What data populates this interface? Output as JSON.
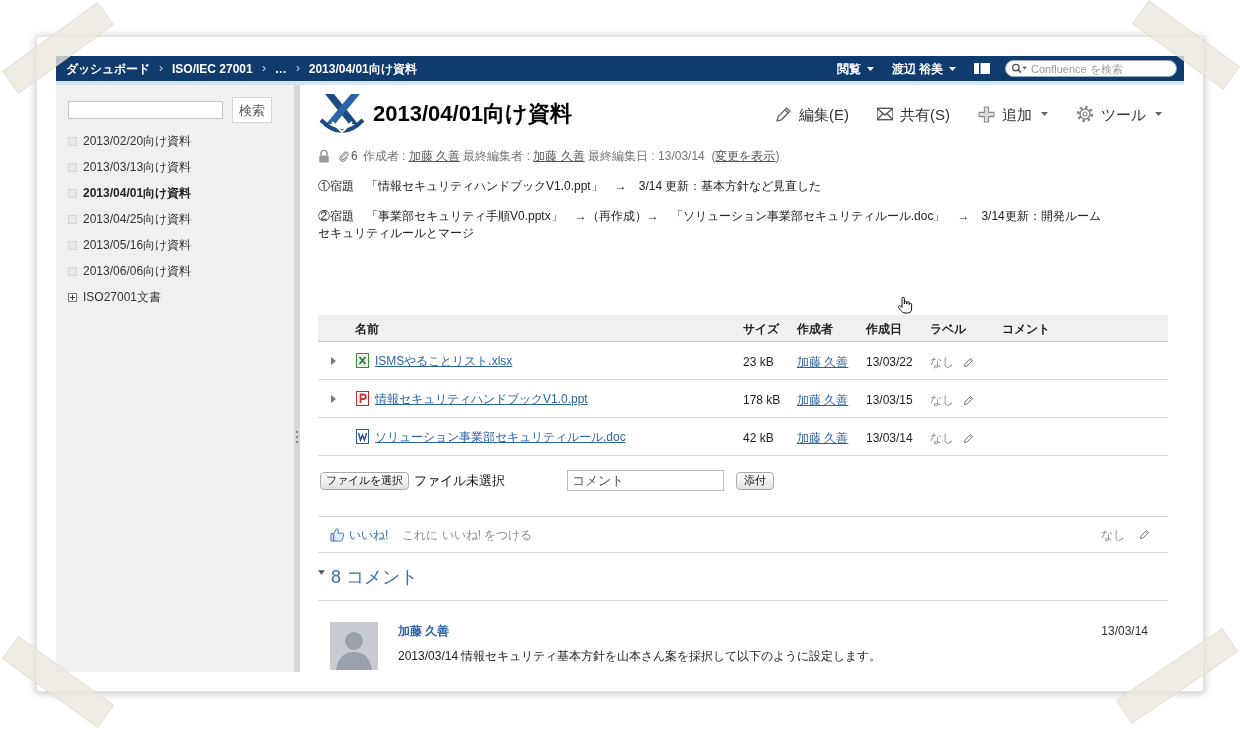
{
  "header": {
    "breadcrumbs": [
      "ダッシュボード",
      "ISO/IEC 27001",
      "…",
      "2013/04/01向け資料"
    ],
    "menus": [
      "閲覧",
      "渡辺 裕美"
    ],
    "search": {
      "placeholder": "Confluence を検索"
    }
  },
  "sidebar": {
    "search_button": "検索",
    "items": [
      {
        "label": "2013/02/20向け資料",
        "selected": false
      },
      {
        "label": "2013/03/13向け資料",
        "selected": false
      },
      {
        "label": "2013/04/01向け資料",
        "selected": true
      },
      {
        "label": "2013/04/25向け資料",
        "selected": false
      },
      {
        "label": "2013/05/16向け資料",
        "selected": false
      },
      {
        "label": "2013/06/06向け資料",
        "selected": false
      },
      {
        "label": "ISO27001文書",
        "selected": false,
        "expanded": false
      }
    ]
  },
  "page": {
    "title": "2013/04/01向け資料",
    "actions": [
      {
        "kind": "edit",
        "label": "編集(E)",
        "dropdown": false
      },
      {
        "kind": "share",
        "label": "共有(S)",
        "dropdown": false
      },
      {
        "kind": "add",
        "label": "追加",
        "dropdown": true
      },
      {
        "kind": "tools",
        "label": "ツール",
        "dropdown": true
      }
    ],
    "metadata": {
      "attachment_count": "6",
      "parts": [
        {
          "kind": "text",
          "text": "作成者 : "
        },
        {
          "kind": "user",
          "text": "加藤 久善"
        },
        {
          "kind": "text",
          "text": " 最終編集者 : "
        },
        {
          "kind": "user",
          "text": "加藤 久善"
        },
        {
          "kind": "text",
          "text": " 最終編集日 : 13/03/14  ("
        },
        {
          "kind": "link",
          "text": "変更を表示"
        },
        {
          "kind": "text",
          "text": ")"
        }
      ]
    },
    "paragraphs": [
      "①宿題　「情報セキュリティハンドブックV1.0.ppt」　→　3/14 更新：基本方針など見直した",
      "②宿題　「事業部セキュリティ手順V0.pptx」　→（再作成）→　「ソリューション事業部セキュリティルール.doc」　→　3/14更新：開発ルームセキュリティルールとマージ"
    ]
  },
  "attachments": {
    "columns": [
      "名前",
      "サイズ",
      "作成者",
      "作成日",
      "ラベル",
      "コメント"
    ],
    "rows": [
      {
        "expandable": true,
        "kind": "xlsx",
        "name": "ISMSやることリスト.xlsx",
        "size": "23 kB",
        "creator": "加藤 久善",
        "date": "13/03/22",
        "labels": "なし"
      },
      {
        "expandable": true,
        "kind": "ppt",
        "name": "情報セキュリティハンドブックV1.0.ppt",
        "size": "178 kB",
        "creator": "加藤 久善",
        "date": "13/03/15",
        "labels": "なし"
      },
      {
        "expandable": false,
        "kind": "doc",
        "name": "ソリューション事業部セキュリティルール.doc",
        "size": "42 kB",
        "creator": "加藤 久善",
        "date": "13/03/14",
        "labels": "なし"
      }
    ]
  },
  "upload": {
    "choose_button": "ファイルを選択",
    "file_status": "ファイル未選択",
    "comment": {
      "placeholder": "コメント"
    },
    "attach_button": "添付"
  },
  "like": {
    "button": "いいね!",
    "prompt": "これに いいね! をつける",
    "labels": "なし"
  },
  "comments": {
    "heading": "8 コメント",
    "expanded": true,
    "items": [
      {
        "author": "加藤 久善",
        "date": "13/03/14",
        "text": "2013/03/14 情報セキュリティ基本方針を山本さん案を採択して以下のように設定します。"
      }
    ]
  }
}
